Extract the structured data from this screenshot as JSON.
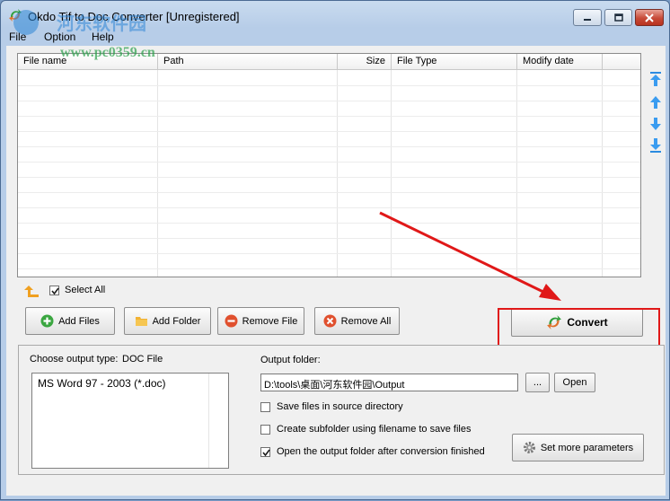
{
  "window": {
    "title": "Okdo Tif to Doc Converter [Unregistered]"
  },
  "menu": [
    "File",
    "Option",
    "Help"
  ],
  "watermark": {
    "site_cn": "河东软件园",
    "url": "www.pc0359.cn"
  },
  "file_table": {
    "columns": [
      "File name",
      "Path",
      "Size",
      "File Type",
      "Modify date"
    ],
    "rows": []
  },
  "select_all_label": "Select All",
  "buttons": {
    "add_files": "Add Files",
    "add_folder": "Add Folder",
    "remove_file": "Remove File",
    "remove_all": "Remove All",
    "convert": "Convert",
    "browse": "...",
    "open": "Open",
    "set_more": "Set more parameters"
  },
  "output": {
    "type_label": "Choose output type:",
    "type_value": "DOC File",
    "type_options": [
      "MS Word 97 - 2003 (*.doc)"
    ],
    "folder_label": "Output folder:",
    "folder_value": "D:\\tools\\桌面\\河东软件园\\Output"
  },
  "options": [
    {
      "label": "Save files in source directory",
      "checked": false
    },
    {
      "label": "Create subfolder using filename to save files",
      "checked": false
    },
    {
      "label": "Open the output folder after conversion finished",
      "checked": true
    }
  ],
  "colors": {
    "accent_red": "#e01818",
    "title_bg": "#b7cde8"
  }
}
